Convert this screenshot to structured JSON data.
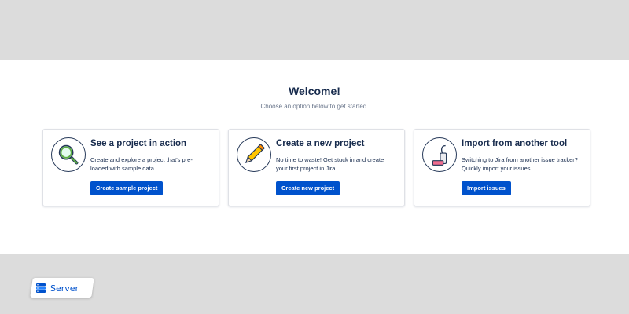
{
  "header": {
    "title": "Welcome!",
    "subtitle": "Choose an option below to get started."
  },
  "cards": [
    {
      "title": "See a project in action",
      "description": "Create and explore a project that's pre-loaded with sample data.",
      "button_label": "Create sample project",
      "icon": "magnifier-icon"
    },
    {
      "title": "Create a new project",
      "description": "No time to waste! Get stuck in and create your first project in Jira.",
      "button_label": "Create new project",
      "icon": "pencil-icon"
    },
    {
      "title": "Import from another tool",
      "description": "Switching to Jira from another issue tracker? Quickly import your issues.",
      "button_label": "Import issues",
      "icon": "vacuum-icon"
    }
  ],
  "badge": {
    "label": "Server",
    "icon": "server-stack-icon"
  },
  "colors": {
    "primary": "#0052cc",
    "text": "#172b4d",
    "subtle_text": "#6b778c",
    "background_band": "#dcdcdc"
  }
}
